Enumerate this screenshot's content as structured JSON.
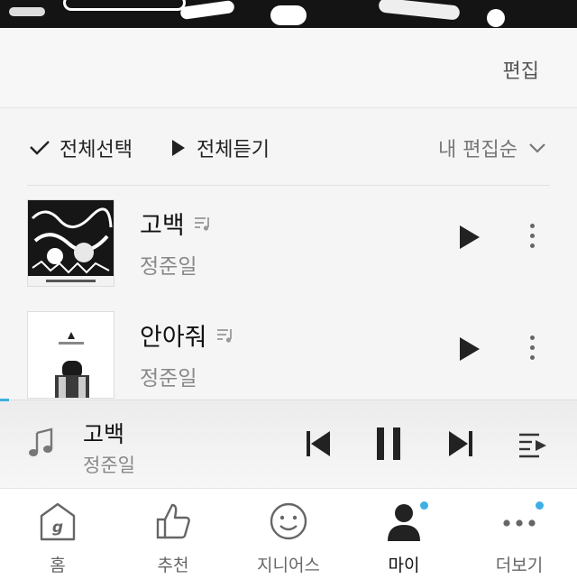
{
  "header": {
    "edit_label": "편집"
  },
  "controls": {
    "select_all_label": "전체선택",
    "play_all_label": "전체듣기",
    "sort_label": "내 편집순"
  },
  "tracks": [
    {
      "title": "고백",
      "artist": "정준일"
    },
    {
      "title": "안아줘",
      "artist": "정준일"
    }
  ],
  "player": {
    "title": "고백",
    "artist": "정준일",
    "progress_fraction": 0.015
  },
  "tabs": [
    {
      "label": "홈",
      "icon": "home-g-icon"
    },
    {
      "label": "추천",
      "icon": "thumbs-up-icon"
    },
    {
      "label": "지니어스",
      "icon": "smiley-icon"
    },
    {
      "label": "마이",
      "icon": "person-icon",
      "active": true
    },
    {
      "label": "더보기",
      "icon": "more-dots-icon"
    }
  ],
  "colors": {
    "accent": "#3db0e6",
    "background": "#f5f5f5"
  }
}
